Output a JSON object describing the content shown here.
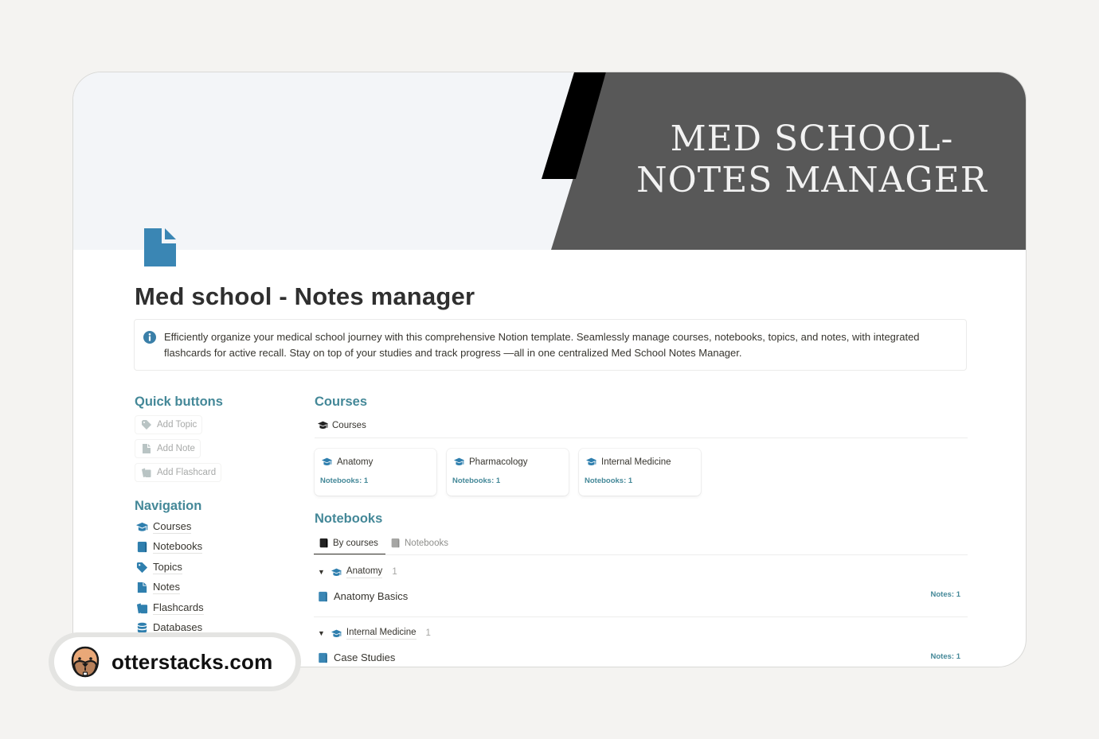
{
  "cover": {
    "title_line1": "MED SCHOOL-",
    "title_line2": "NOTES MANAGER",
    "colors": {
      "background": "#f3f5f8",
      "dark_panel": "#585858",
      "black_stripe": "#000000"
    }
  },
  "page": {
    "icon": "document-icon",
    "title": "Med school - Notes manager"
  },
  "callout": {
    "icon": "info-icon",
    "text": "Efficiently organize your medical school journey with this comprehensive Notion template. Seamlessly manage courses, notebooks, topics, and notes, with integrated flashcards for active recall. Stay on top of your studies and track progress —all in one centralized Med School Notes Manager."
  },
  "quick_buttons": {
    "heading": "Quick buttons",
    "items": [
      {
        "label": "Add Topic",
        "icon": "tag-icon"
      },
      {
        "label": "Add Note",
        "icon": "document-icon"
      },
      {
        "label": "Add Flashcard",
        "icon": "flashcards-icon"
      }
    ]
  },
  "navigation": {
    "heading": "Navigation",
    "items": [
      {
        "label": "Courses",
        "icon": "graduation-cap-icon"
      },
      {
        "label": "Notebooks",
        "icon": "notebook-icon"
      },
      {
        "label": "Topics",
        "icon": "tag-icon"
      },
      {
        "label": "Notes",
        "icon": "document-icon"
      },
      {
        "label": "Flashcards",
        "icon": "flashcards-icon"
      },
      {
        "label": "Databases",
        "icon": "database-icon"
      }
    ]
  },
  "courses": {
    "heading": "Courses",
    "view_tab": "Courses",
    "cards": [
      {
        "title": "Anatomy",
        "property": "Notebooks: 1"
      },
      {
        "title": "Pharmacology",
        "property": "Notebooks: 1"
      },
      {
        "title": "Internal Medicine",
        "property": "Notebooks: 1"
      }
    ]
  },
  "notebooks": {
    "heading": "Notebooks",
    "tabs": [
      {
        "label": "By courses",
        "active": true
      },
      {
        "label": "Notebooks",
        "active": false
      }
    ],
    "groups": [
      {
        "name": "Anatomy",
        "count": "1",
        "rows": [
          {
            "title": "Anatomy Basics",
            "notes": "Notes: 1"
          }
        ]
      },
      {
        "name": "Internal Medicine",
        "count": "1",
        "rows": [
          {
            "title": "Case Studies",
            "notes": "Notes: 1"
          }
        ]
      }
    ]
  },
  "watermark": {
    "text": "otterstacks.com",
    "logo": "otter-face-icon"
  },
  "colors": {
    "accent": "#448898",
    "icon_blue": "#2f7fae",
    "text": "#37352f"
  }
}
